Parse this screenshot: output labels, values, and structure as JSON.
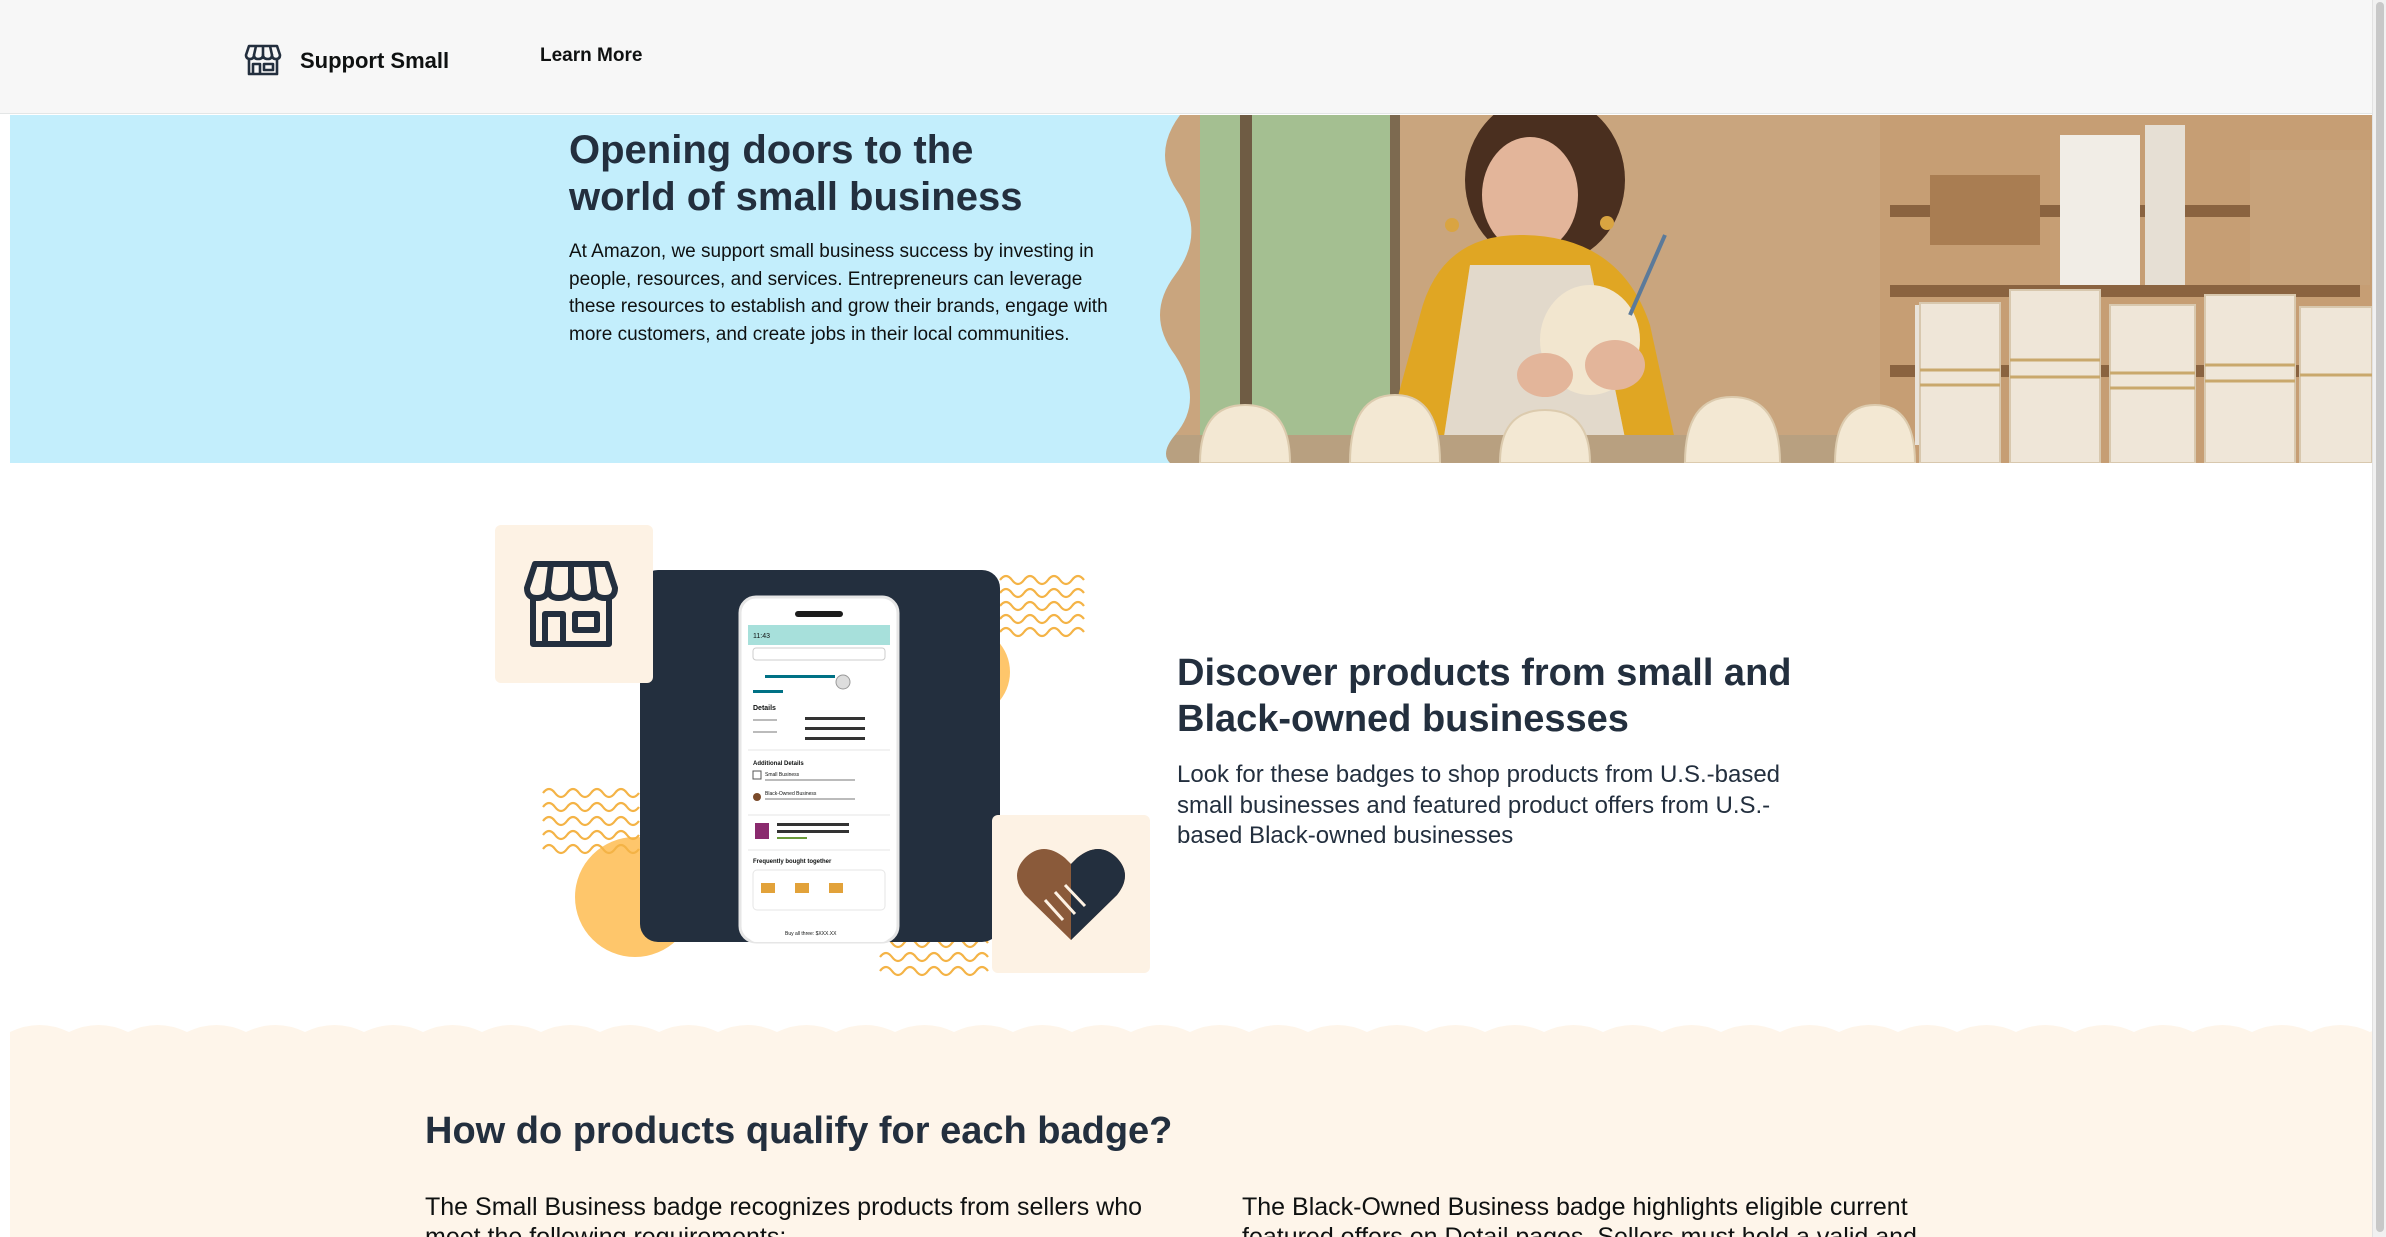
{
  "nav": {
    "brand": "Support Small",
    "learn_more": "Learn More"
  },
  "hero": {
    "title_line1": "Opening doors to the",
    "title_line2": "world of small business",
    "body": "At Amazon, we support small business success by investing in people, resources, and services. Entrepreneurs can leverage these resources to establish and grow their brands, engage with more customers, and create jobs in their local communities."
  },
  "discover": {
    "title": "Discover products from small and Black-owned businesses",
    "body": "Look for these badges to shop products from U.S.-based small businesses and featured product offers from U.S.-based Black-owned businesses",
    "phone": {
      "time": "11:43",
      "details": "Details",
      "additional_details": "Additional Details",
      "small_business": "Small Business",
      "black_owned_business": "Black-Owned Business",
      "frequently_bought": "Frequently bought together",
      "buy_all": "Buy all three: $XXX.XX"
    }
  },
  "badges": {
    "title": "How do products qualify for each badge?",
    "left": "The Small Business badge recognizes products from sellers who meet the following requirements:",
    "right": "The Black-Owned Business badge highlights eligible current featured offers on Detail pages. Sellers must hold a valid and"
  },
  "colors": {
    "nav_bg": "#f7f7f7",
    "hero_bg": "#c3eefc",
    "badge_section_bg": "#fef5ea",
    "navy": "#232f3e",
    "accent_orange": "#fec66b",
    "cream_tile": "#fdf2e4"
  },
  "icons": {
    "brand": "storefront-icon",
    "store_tile": "storefront-icon",
    "handshake_tile": "handshake-heart-icon"
  }
}
